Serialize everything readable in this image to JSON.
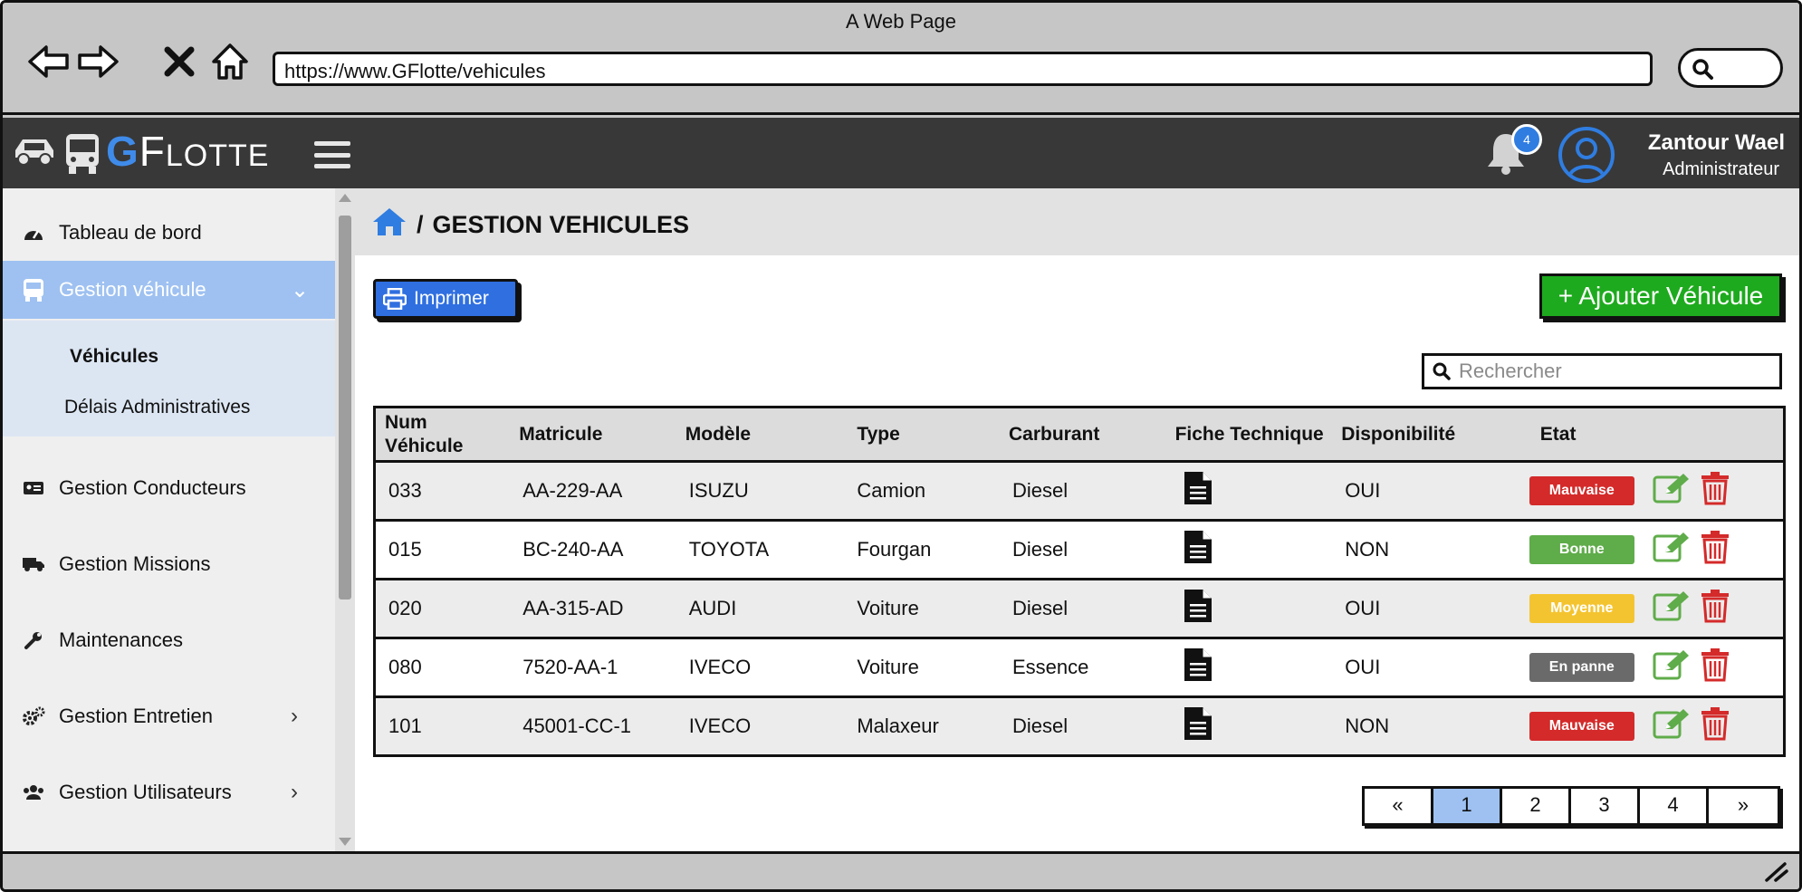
{
  "browser": {
    "title": "A Web Page",
    "url": "https://www.GFlotte/vehicules"
  },
  "header": {
    "logo_g": "G",
    "logo_f": "F",
    "logo_rest": "LOTTE",
    "notification_count": "4",
    "user_name": "Zantour Wael",
    "user_role": "Administrateur"
  },
  "sidebar": {
    "items": [
      {
        "label": "Tableau de bord",
        "icon": "dashboard-icon"
      },
      {
        "label": "Gestion véhicule",
        "icon": "bus-icon"
      },
      {
        "label": "Gestion Conducteurs",
        "icon": "id-card-icon"
      },
      {
        "label": "Gestion Missions",
        "icon": "truck-icon"
      },
      {
        "label": "Maintenances",
        "icon": "wrench-icon"
      },
      {
        "label": "Gestion Entretien",
        "icon": "gears-icon"
      },
      {
        "label": "Gestion Utilisateurs",
        "icon": "users-icon"
      }
    ],
    "subitems": [
      "Véhicules",
      "Délais Administratives"
    ]
  },
  "main": {
    "breadcrumb": "GESTION VEHICULES",
    "print_label": "Imprimer",
    "add_label": "+ Ajouter Véhicule",
    "search_placeholder": "Rechercher",
    "columns": [
      "Num Véhicule",
      "Matricule",
      "Modèle",
      "Type",
      "Carburant",
      "Fiche Technique",
      "Disponibilité",
      "Etat"
    ],
    "rows": [
      {
        "num": "033",
        "matricule": "AA-229-AA",
        "modele": "ISUZU",
        "type": "Camion",
        "carburant": "Diesel",
        "dispo": "OUI",
        "etat": "Mauvaise",
        "etat_color": "#d42a2a"
      },
      {
        "num": "015",
        "matricule": "BC-240-AA",
        "modele": "TOYOTA",
        "type": "Fourgan",
        "carburant": "Diesel",
        "dispo": "NON",
        "etat": "Bonne",
        "etat_color": "#5fac4a"
      },
      {
        "num": "020",
        "matricule": "AA-315-AD",
        "modele": "AUDI",
        "type": "Voiture",
        "carburant": "Diesel",
        "dispo": "OUI",
        "etat": "Moyenne",
        "etat_color": "#f4c430"
      },
      {
        "num": "080",
        "matricule": "7520-AA-1",
        "modele": "IVECO",
        "type": "Voiture",
        "carburant": "Essence",
        "dispo": "OUI",
        "etat": "En panne",
        "etat_color": "#6a6a6a"
      },
      {
        "num": "101",
        "matricule": "45001-CC-1",
        "modele": "IVECO",
        "type": "Malaxeur",
        "carburant": "Diesel",
        "dispo": "NON",
        "etat": "Mauvaise",
        "etat_color": "#d42a2a"
      }
    ],
    "pagination": [
      "«",
      "1",
      "2",
      "3",
      "4",
      "»"
    ],
    "active_page": "1"
  },
  "colors": {
    "accent": "#2f7de1",
    "sidebar_active": "#9ec1f1",
    "add_button": "#1eaa1e",
    "edit_icon": "#5fac4a",
    "delete_icon": "#d42a2a"
  }
}
